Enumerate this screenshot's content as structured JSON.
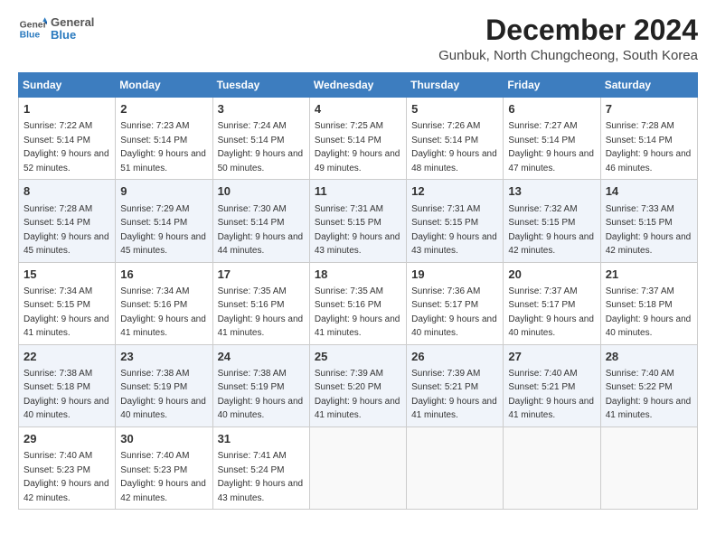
{
  "header": {
    "logo_general": "General",
    "logo_blue": "Blue",
    "month_title": "December 2024",
    "subtitle": "Gunbuk, North Chungcheong, South Korea"
  },
  "weekdays": [
    "Sunday",
    "Monday",
    "Tuesday",
    "Wednesday",
    "Thursday",
    "Friday",
    "Saturday"
  ],
  "weeks": [
    [
      {
        "day": "1",
        "sunrise": "7:22 AM",
        "sunset": "5:14 PM",
        "daylight": "9 hours and 52 minutes."
      },
      {
        "day": "2",
        "sunrise": "7:23 AM",
        "sunset": "5:14 PM",
        "daylight": "9 hours and 51 minutes."
      },
      {
        "day": "3",
        "sunrise": "7:24 AM",
        "sunset": "5:14 PM",
        "daylight": "9 hours and 50 minutes."
      },
      {
        "day": "4",
        "sunrise": "7:25 AM",
        "sunset": "5:14 PM",
        "daylight": "9 hours and 49 minutes."
      },
      {
        "day": "5",
        "sunrise": "7:26 AM",
        "sunset": "5:14 PM",
        "daylight": "9 hours and 48 minutes."
      },
      {
        "day": "6",
        "sunrise": "7:27 AM",
        "sunset": "5:14 PM",
        "daylight": "9 hours and 47 minutes."
      },
      {
        "day": "7",
        "sunrise": "7:28 AM",
        "sunset": "5:14 PM",
        "daylight": "9 hours and 46 minutes."
      }
    ],
    [
      {
        "day": "8",
        "sunrise": "7:28 AM",
        "sunset": "5:14 PM",
        "daylight": "9 hours and 45 minutes."
      },
      {
        "day": "9",
        "sunrise": "7:29 AM",
        "sunset": "5:14 PM",
        "daylight": "9 hours and 45 minutes."
      },
      {
        "day": "10",
        "sunrise": "7:30 AM",
        "sunset": "5:14 PM",
        "daylight": "9 hours and 44 minutes."
      },
      {
        "day": "11",
        "sunrise": "7:31 AM",
        "sunset": "5:15 PM",
        "daylight": "9 hours and 43 minutes."
      },
      {
        "day": "12",
        "sunrise": "7:31 AM",
        "sunset": "5:15 PM",
        "daylight": "9 hours and 43 minutes."
      },
      {
        "day": "13",
        "sunrise": "7:32 AM",
        "sunset": "5:15 PM",
        "daylight": "9 hours and 42 minutes."
      },
      {
        "day": "14",
        "sunrise": "7:33 AM",
        "sunset": "5:15 PM",
        "daylight": "9 hours and 42 minutes."
      }
    ],
    [
      {
        "day": "15",
        "sunrise": "7:34 AM",
        "sunset": "5:15 PM",
        "daylight": "9 hours and 41 minutes."
      },
      {
        "day": "16",
        "sunrise": "7:34 AM",
        "sunset": "5:16 PM",
        "daylight": "9 hours and 41 minutes."
      },
      {
        "day": "17",
        "sunrise": "7:35 AM",
        "sunset": "5:16 PM",
        "daylight": "9 hours and 41 minutes."
      },
      {
        "day": "18",
        "sunrise": "7:35 AM",
        "sunset": "5:16 PM",
        "daylight": "9 hours and 41 minutes."
      },
      {
        "day": "19",
        "sunrise": "7:36 AM",
        "sunset": "5:17 PM",
        "daylight": "9 hours and 40 minutes."
      },
      {
        "day": "20",
        "sunrise": "7:37 AM",
        "sunset": "5:17 PM",
        "daylight": "9 hours and 40 minutes."
      },
      {
        "day": "21",
        "sunrise": "7:37 AM",
        "sunset": "5:18 PM",
        "daylight": "9 hours and 40 minutes."
      }
    ],
    [
      {
        "day": "22",
        "sunrise": "7:38 AM",
        "sunset": "5:18 PM",
        "daylight": "9 hours and 40 minutes."
      },
      {
        "day": "23",
        "sunrise": "7:38 AM",
        "sunset": "5:19 PM",
        "daylight": "9 hours and 40 minutes."
      },
      {
        "day": "24",
        "sunrise": "7:38 AM",
        "sunset": "5:19 PM",
        "daylight": "9 hours and 40 minutes."
      },
      {
        "day": "25",
        "sunrise": "7:39 AM",
        "sunset": "5:20 PM",
        "daylight": "9 hours and 41 minutes."
      },
      {
        "day": "26",
        "sunrise": "7:39 AM",
        "sunset": "5:21 PM",
        "daylight": "9 hours and 41 minutes."
      },
      {
        "day": "27",
        "sunrise": "7:40 AM",
        "sunset": "5:21 PM",
        "daylight": "9 hours and 41 minutes."
      },
      {
        "day": "28",
        "sunrise": "7:40 AM",
        "sunset": "5:22 PM",
        "daylight": "9 hours and 41 minutes."
      }
    ],
    [
      {
        "day": "29",
        "sunrise": "7:40 AM",
        "sunset": "5:23 PM",
        "daylight": "9 hours and 42 minutes."
      },
      {
        "day": "30",
        "sunrise": "7:40 AM",
        "sunset": "5:23 PM",
        "daylight": "9 hours and 42 minutes."
      },
      {
        "day": "31",
        "sunrise": "7:41 AM",
        "sunset": "5:24 PM",
        "daylight": "9 hours and 43 minutes."
      },
      null,
      null,
      null,
      null
    ]
  ],
  "labels": {
    "sunrise": "Sunrise:",
    "sunset": "Sunset:",
    "daylight": "Daylight:"
  }
}
